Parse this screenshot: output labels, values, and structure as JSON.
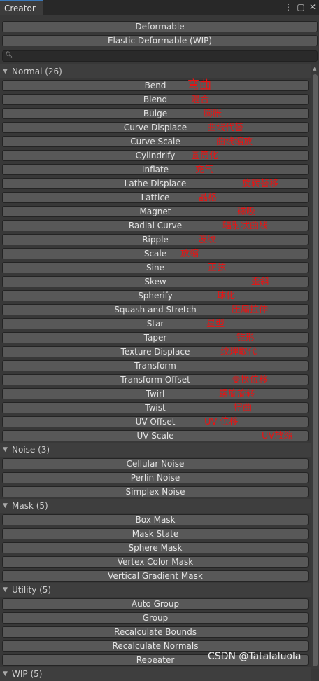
{
  "window": {
    "tab_title": "Creator",
    "icons": [
      "more-vertical-icon",
      "maximize-icon",
      "close-icon"
    ]
  },
  "top_buttons": [
    "Deformable",
    "Elastic Deformable (WIP)"
  ],
  "search": {
    "placeholder": ""
  },
  "sections": [
    {
      "label": "Normal (26)",
      "items": [
        {
          "label": "Bend",
          "note": "弯曲"
        },
        {
          "label": "Blend",
          "note": "混合"
        },
        {
          "label": "Bulge",
          "note": "膨胀"
        },
        {
          "label": "Curve Displace",
          "note": "曲线代替"
        },
        {
          "label": "Curve Scale",
          "note": "曲线缩放"
        },
        {
          "label": "Cylindrify",
          "note": "圆筒化"
        },
        {
          "label": "Inflate",
          "note": "充气"
        },
        {
          "label": "Lathe Displace",
          "note": "旋转替移"
        },
        {
          "label": "Lattice",
          "note": "晶格"
        },
        {
          "label": "Magnet",
          "note": "磁吸"
        },
        {
          "label": "Radial Curve",
          "note": "辐射状曲线"
        },
        {
          "label": "Ripple",
          "note": "波纹"
        },
        {
          "label": "Scale",
          "note": "放缩"
        },
        {
          "label": "Sine",
          "note": "正弦"
        },
        {
          "label": "Skew",
          "note": "歪斜"
        },
        {
          "label": "Spherify",
          "note": "球化"
        },
        {
          "label": "Squash and Stretch",
          "note": "压扁拉伸"
        },
        {
          "label": "Star",
          "note": "星型"
        },
        {
          "label": "Taper",
          "note": "锥形"
        },
        {
          "label": "Texture Displace",
          "note": "纹理取代"
        },
        {
          "label": "Transform",
          "note": ""
        },
        {
          "label": "Transform Offset",
          "note": "变换位移"
        },
        {
          "label": "Twirl",
          "note": "螺旋旋转"
        },
        {
          "label": "Twist",
          "note": "扭曲"
        },
        {
          "label": "UV Offset",
          "note": "UV 位移"
        },
        {
          "label": "UV Scale",
          "note": "UV放缩"
        }
      ]
    },
    {
      "label": "Noise (3)",
      "items": [
        {
          "label": "Cellular Noise",
          "note": ""
        },
        {
          "label": "Perlin Noise",
          "note": ""
        },
        {
          "label": "Simplex Noise",
          "note": ""
        }
      ]
    },
    {
      "label": "Mask (5)",
      "items": [
        {
          "label": "Box Mask",
          "note": ""
        },
        {
          "label": "Mask State",
          "note": ""
        },
        {
          "label": "Sphere Mask",
          "note": ""
        },
        {
          "label": "Vertex Color Mask",
          "note": ""
        },
        {
          "label": "Vertical Gradient Mask",
          "note": ""
        }
      ]
    },
    {
      "label": "Utility (5)",
      "items": [
        {
          "label": "Auto Group",
          "note": ""
        },
        {
          "label": "Group",
          "note": ""
        },
        {
          "label": "Recalculate Bounds",
          "note": ""
        },
        {
          "label": "Recalculate Normals",
          "note": ""
        },
        {
          "label": "Repeater",
          "note": ""
        }
      ]
    },
    {
      "label": "WIP (5)",
      "items": []
    }
  ],
  "watermark": "CSDN @Tatalaluola"
}
